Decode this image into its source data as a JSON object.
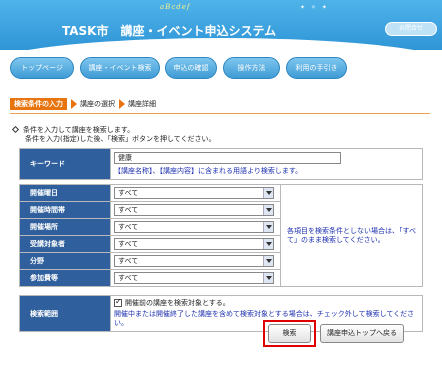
{
  "header": {
    "title": "TASK市　講座・イベント申込システム",
    "deco_text": "aBcdef",
    "inquiry_label": "お問合せ"
  },
  "nav": {
    "items": [
      "トップページ",
      "講座・イベント検索",
      "申込の確認",
      "操作方法",
      "利用の手引き"
    ]
  },
  "steps": {
    "active": "検索条件の入力",
    "step2": "講座の選択",
    "step3": "講座詳細"
  },
  "intro": {
    "line1": "条件を入力して講座を検索します。",
    "line2": "条件を入力(指定)した後、「検索」ボタンを押してください。"
  },
  "form": {
    "keyword_label": "キーワード",
    "keyword_value": "健康",
    "keyword_note": "【講座名称】、【講座内容】に含まれる用語より検索します。",
    "fields": [
      {
        "label": "開催曜日",
        "value": "すべて"
      },
      {
        "label": "開催時間帯",
        "value": "すべて"
      },
      {
        "label": "開催場所",
        "value": "すべて"
      },
      {
        "label": "受講対象者",
        "value": "すべて"
      },
      {
        "label": "分野",
        "value": "すべて"
      },
      {
        "label": "参加費等",
        "value": "すべて"
      }
    ],
    "side_note": "各項目を検索条件としない場合は、「すべて」のまま検索してください。",
    "range_label": "検索範囲",
    "range_checkbox_label": "開催前の講座を検索対象とする。",
    "range_checked": true,
    "range_note": "開催中または開催終了した講座を含めて検索対象とする場合は、チェック外して検索してください。"
  },
  "buttons": {
    "search": "検索",
    "back": "講座申込トップへ戻る"
  },
  "colors": {
    "header_blue": "#2f95d6",
    "label_bg": "#2f5f9c",
    "step_orange": "#e8740f",
    "highlight_red": "#e00000"
  }
}
